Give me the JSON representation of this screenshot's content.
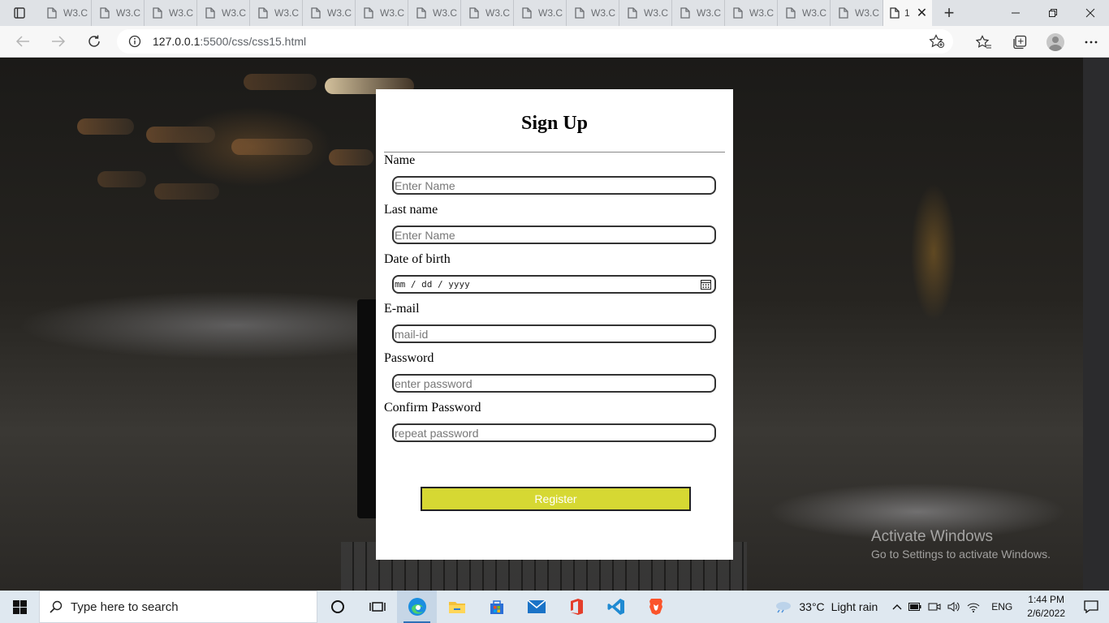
{
  "browser": {
    "tabs": [
      {
        "label": "W3.C"
      },
      {
        "label": "W3.C"
      },
      {
        "label": "W3.C"
      },
      {
        "label": "W3.C"
      },
      {
        "label": "W3.C"
      },
      {
        "label": "W3.C"
      },
      {
        "label": "W3.C"
      },
      {
        "label": "W3.C"
      },
      {
        "label": "W3.C"
      },
      {
        "label": "W3.C"
      },
      {
        "label": "W3.C"
      },
      {
        "label": "W3.C"
      },
      {
        "label": "W3.C"
      },
      {
        "label": "W3.C"
      },
      {
        "label": "W3.C"
      },
      {
        "label": "W3.C"
      }
    ],
    "active_tab": {
      "label": "1",
      "close_glyph": "✕"
    },
    "new_tab_glyph": "+",
    "url_host": "127.0.0.1",
    "url_path": ":5500/css/css15.html"
  },
  "form": {
    "title": "Sign Up",
    "name_label": "Name",
    "name_placeholder": "Enter Name",
    "lastname_label": "Last name",
    "lastname_placeholder": "Enter Name",
    "dob_label": "Date of birth",
    "dob_placeholder": "mm / dd / yyyy",
    "email_label": "E-mail",
    "email_placeholder": "mail-id",
    "password_label": "Password",
    "password_placeholder": "enter password",
    "confirm_label": "Confirm Password",
    "confirm_placeholder": "repeat password",
    "register_label": "Register",
    "register_color": "#d6d833"
  },
  "watermark": {
    "line1": "Activate Windows",
    "line2": "Go to Settings to activate Windows."
  },
  "taskbar": {
    "search_placeholder": "Type here to search",
    "weather_temp": "33°C",
    "weather_desc": "Light rain",
    "language": "ENG",
    "time": "1:44 PM",
    "date": "2/6/2022"
  }
}
